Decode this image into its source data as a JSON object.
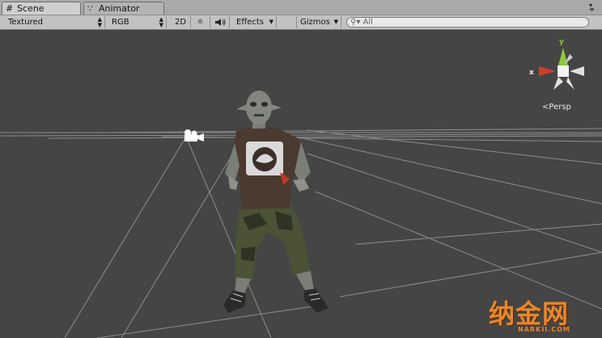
{
  "tabs": [
    {
      "label": "Scene",
      "icon": "grid-icon",
      "active": true
    },
    {
      "label": "Animator",
      "icon": "animator-icon",
      "active": false
    }
  ],
  "toolbar": {
    "draw_mode": "Textured",
    "render_mode": "RGB",
    "mode_2d": "2D",
    "lighting_icon": "sun-icon",
    "audio_icon": "speaker-icon",
    "effects": "Effects",
    "gizmos": "Gizmos",
    "search_placeholder": "All"
  },
  "gizmo": {
    "x_label": "x",
    "y_label": "y",
    "projection": "Persp",
    "colors": {
      "x": "#d23c2b",
      "y": "#8dc63f",
      "z": "#ffffff"
    }
  },
  "scene": {
    "camera_icon": "camera-icon",
    "character": "zombie-character",
    "background": "#454545",
    "grid_color": "#a6a6a6"
  },
  "watermark": {
    "text": "纳金网",
    "subtext": "NARKII.COM",
    "color": "#e9862c"
  }
}
